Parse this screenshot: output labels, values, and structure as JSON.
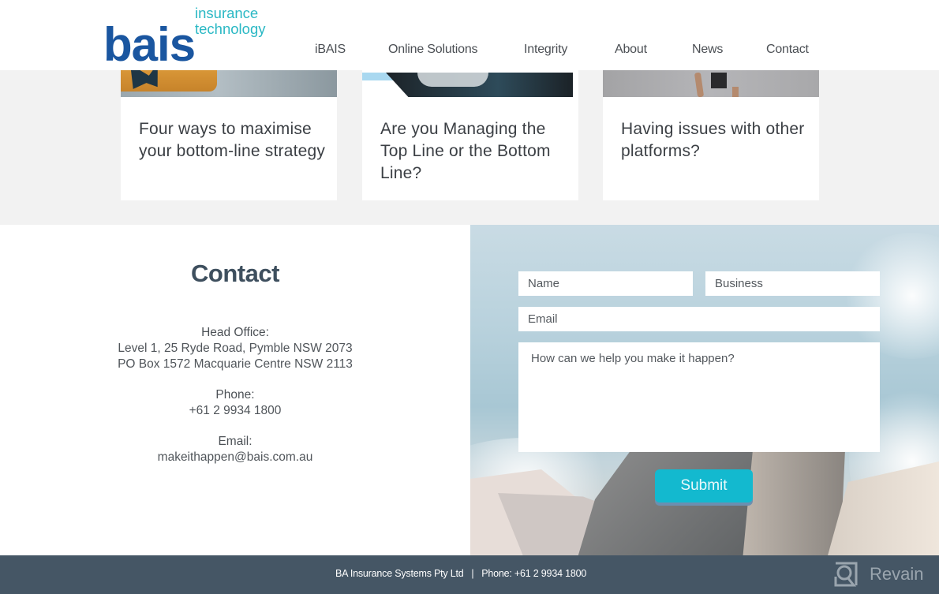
{
  "header": {
    "logo": {
      "main": "bais",
      "line1": "insurance",
      "line2": "technology"
    },
    "nav": [
      {
        "label": "iBAIS"
      },
      {
        "label": "Online Solutions"
      },
      {
        "label": "Integrity"
      },
      {
        "label": "About"
      },
      {
        "label": "News"
      },
      {
        "label": "Contact"
      }
    ]
  },
  "blog": {
    "cards": [
      {
        "title": "Four ways to maximise your bottom-line strategy"
      },
      {
        "title": "Are you Managing the Top Line or the Bottom Line?"
      },
      {
        "title": "Having issues with other platforms?"
      }
    ]
  },
  "contact": {
    "heading": "Contact",
    "head_office_label": "Head Office:",
    "address_line1": "Level 1, 25 Ryde Road, Pymble NSW 2073",
    "address_line2": "PO Box 1572 Macquarie Centre NSW 2113",
    "phone_label": "Phone:",
    "phone": "+61 2 9934 1800",
    "email_label": "Email:",
    "email": "makeithappen@bais.com.au"
  },
  "form": {
    "name_placeholder": "Name",
    "business_placeholder": "Business",
    "email_placeholder": "Email",
    "message_placeholder": "How can we help you make it happen?",
    "submit_label": "Submit",
    "accent_color": "#13b9cf"
  },
  "footer": {
    "text": "BA Insurance Systems Pty Ltd   |   Phone: +61 2 9934 1800",
    "watermark": "Revain"
  }
}
